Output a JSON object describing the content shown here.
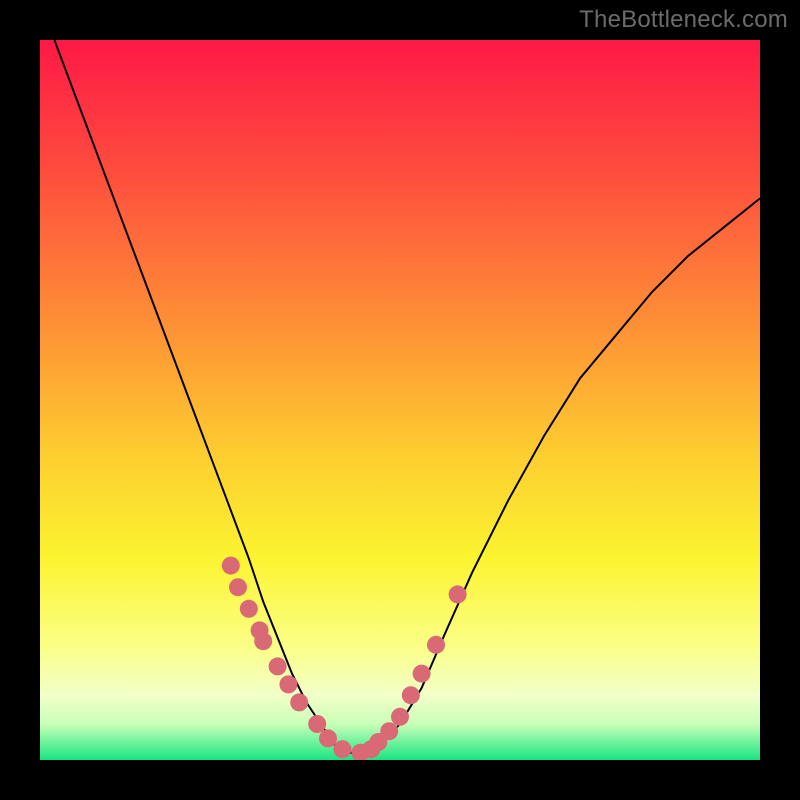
{
  "attribution": "TheBottleneck.com",
  "colors": {
    "gradient_top": "#fe1946",
    "gradient_mid_upper": "#fe8637",
    "gradient_mid": "#fcef30",
    "gradient_lower": "#faffa0",
    "gradient_bottom": "#18e582",
    "marker": "#d96a75",
    "curve": "#000000",
    "frame": "#000000"
  },
  "chart_data": {
    "type": "line",
    "title": "",
    "xlabel": "",
    "ylabel": "",
    "xlim": [
      0,
      100
    ],
    "ylim": [
      0,
      100
    ],
    "grid": false,
    "series": [
      {
        "name": "bottleneck-curve",
        "x_note": "x is left-to-right 0–100; y is value 0 (bottom, green) to 100 (top, red), approximated from pixels",
        "x": [
          2,
          5,
          8,
          11,
          14,
          17,
          20,
          23,
          26,
          29,
          31,
          33,
          35,
          37,
          39,
          41,
          43,
          45,
          47,
          50,
          53,
          56,
          60,
          65,
          70,
          75,
          80,
          85,
          90,
          95,
          100
        ],
        "y": [
          100,
          92,
          84,
          76,
          68,
          60,
          52,
          44,
          36,
          28,
          22,
          17,
          12,
          8,
          5,
          2,
          1,
          1,
          2,
          5,
          10,
          17,
          26,
          36,
          45,
          53,
          59,
          65,
          70,
          74,
          78
        ]
      }
    ],
    "markers": {
      "name": "highlighted-points",
      "x": [
        26.5,
        27.5,
        29.0,
        30.5,
        31.0,
        33.0,
        34.5,
        36.0,
        38.5,
        40.0,
        42.0,
        44.5,
        46.0,
        47.0,
        48.5,
        50.0,
        51.5,
        53.0,
        55.0,
        58.0
      ],
      "y": [
        27,
        24,
        21,
        18,
        16.5,
        13,
        10.5,
        8,
        5,
        3,
        1.5,
        1,
        1.5,
        2.5,
        4,
        6,
        9,
        12,
        16,
        23
      ]
    }
  }
}
